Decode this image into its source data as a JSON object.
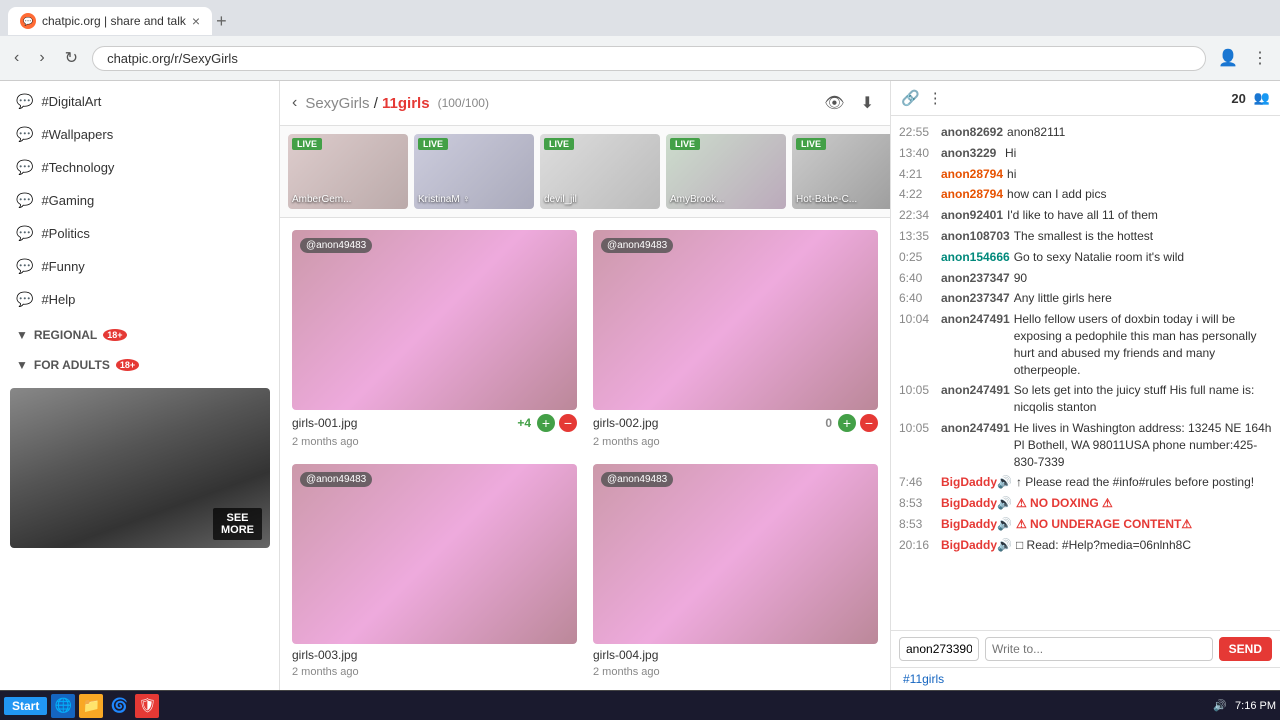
{
  "browser": {
    "tab_title": "chatpic.org | share and talk",
    "tab_close": "×",
    "address": "chatpic.org/r/SexyGirls",
    "new_tab": "+",
    "nav_back": "‹",
    "nav_forward": "›",
    "nav_refresh": "↻",
    "nav_account": "👤",
    "nav_menu": "⋮"
  },
  "sidebar": {
    "items": [
      {
        "label": "#DigitalArt",
        "icon": "💬"
      },
      {
        "label": "#Wallpapers",
        "icon": "💬"
      },
      {
        "label": "#Technology",
        "icon": "💬"
      },
      {
        "label": "#Gaming",
        "icon": "💬"
      },
      {
        "label": "#Politics",
        "icon": "💬"
      },
      {
        "label": "#Funny",
        "icon": "💬"
      },
      {
        "label": "#Help",
        "icon": "💬"
      }
    ],
    "regional_label": "REGIONAL",
    "regional_badge": "18+",
    "adults_label": "FOR ADULTS",
    "adults_badge": "18+",
    "see_more": "SEE\nMORE"
  },
  "room": {
    "back_arrow": "‹",
    "channel": "SexyGirls",
    "separator": " / ",
    "name": "11girls",
    "count_label": "(100/100)",
    "eye_icon": "👁",
    "download_icon": "⬇"
  },
  "live_cards": [
    {
      "label": "LIVE",
      "name": "AmberGem..."
    },
    {
      "label": "LIVE",
      "name": "KristinaM ♀"
    },
    {
      "label": "LIVE",
      "name": "devil_jil"
    },
    {
      "label": "LIVE",
      "name": "AmyBrook..."
    },
    {
      "label": "LIVE",
      "name": "Hot-Babe-C..."
    }
  ],
  "gallery": {
    "items": [
      {
        "user": "@anon49483",
        "filename": "girls-001.jpg",
        "count": "+4",
        "date": "2 months ago"
      },
      {
        "user": "@anon49483",
        "filename": "girls-002.jpg",
        "count": "0",
        "date": "2 months ago"
      },
      {
        "user": "@anon49483",
        "filename": "girls-003.jpg",
        "count": "",
        "date": "2 months ago"
      },
      {
        "user": "@anon49483",
        "filename": "girls-004.jpg",
        "count": "",
        "date": "2 months ago"
      }
    ]
  },
  "chat": {
    "link_icon": "🔗",
    "menu_icon": "⋮",
    "user_count": "20",
    "users_icon": "👥",
    "messages": [
      {
        "time": "22:55",
        "username": "anon82692",
        "username_class": "default",
        "text": "anon82111",
        "text_class": "plain"
      },
      {
        "time": "13:40",
        "username": "anon3229",
        "username_class": "default",
        "text": "Hi",
        "text_class": "plain"
      },
      {
        "time": "4:21",
        "username": "anon28794",
        "username_class": "orange",
        "text": "hi",
        "text_class": "plain"
      },
      {
        "time": "4:22",
        "username": "anon28794",
        "username_class": "orange",
        "text": "how can I add pics",
        "text_class": "plain"
      },
      {
        "time": "22:34",
        "username": "anon92401",
        "username_class": "default",
        "text": "I'd like to have all 11 of them",
        "text_class": "plain"
      },
      {
        "time": "13:35",
        "username": "anon108703",
        "username_class": "default",
        "text": "The smallest is the hottest",
        "text_class": "plain"
      },
      {
        "time": "0:25",
        "username": "anon154666",
        "username_class": "teal",
        "text": "Go to sexy Natalie room it's wild",
        "text_class": "plain"
      },
      {
        "time": "6:40",
        "username": "anon237347",
        "username_class": "default",
        "text": "90",
        "text_class": "plain"
      },
      {
        "time": "6:40",
        "username": "anon237347",
        "username_class": "default",
        "text": "Any little girls here",
        "text_class": "plain"
      },
      {
        "time": "10:04",
        "username": "anon247491",
        "username_class": "default",
        "text": "Hello fellow users of doxbin today i will be exposing a pedophile this man has personally hurt and abused my friends and many otherpeople.",
        "text_class": "plain"
      },
      {
        "time": "10:05",
        "username": "anon247491",
        "username_class": "default",
        "text": "So lets get into the juicy stuff  His full name is: nicqolis stanton",
        "text_class": "plain"
      },
      {
        "time": "10:05",
        "username": "anon247491",
        "username_class": "default",
        "text": "He lives in Washington address: 13245 NE 164h Pl Bothell, WA 98011USA phone number:425-830-7339",
        "text_class": "plain"
      },
      {
        "time": "7:46",
        "username": "BigDaddy🔊",
        "username_class": "red",
        "text": "↑ Please read the #info#rules before posting!",
        "text_class": "mod"
      },
      {
        "time": "8:53",
        "username": "BigDaddy🔊",
        "username_class": "red",
        "text": "⚠ NO DOXING ⚠",
        "text_class": "warn"
      },
      {
        "time": "8:53",
        "username": "BigDaddy🔊",
        "username_class": "red",
        "text": "⚠ NO UNDERAGE CONTENT⚠",
        "text_class": "warn"
      },
      {
        "time": "20:16",
        "username": "BigDaddy🔊",
        "username_class": "red",
        "text": "□ Read: #Help?media=06nlnh8C",
        "text_class": "plain"
      }
    ],
    "input_username": "anon273390",
    "input_placeholder": "Write to...",
    "send_label": "SEND",
    "hashtag": "#11girls"
  },
  "taskbar": {
    "start_label": "Start",
    "time": "7:16 PM"
  }
}
